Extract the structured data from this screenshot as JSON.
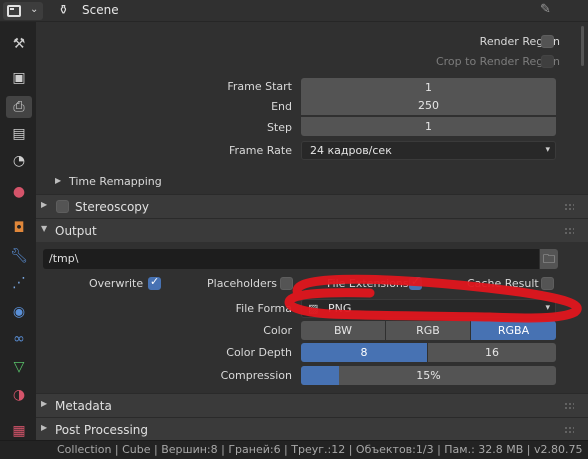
{
  "header": {
    "title": "Scene",
    "editor_icon": "properties-editor-icon",
    "pin_icon": "pin-icon"
  },
  "tabs": [
    {
      "name": "tool",
      "icon": "tool-icon"
    },
    {
      "name": "render",
      "icon": "render-camera-icon"
    },
    {
      "name": "output",
      "icon": "printer-icon",
      "active": true
    },
    {
      "name": "view-layer",
      "icon": "image-icon"
    },
    {
      "name": "scene",
      "icon": "scene-icon"
    },
    {
      "name": "world",
      "icon": "world-icon"
    },
    {
      "name": "object",
      "icon": "object-icon"
    },
    {
      "name": "modifiers",
      "icon": "wrench-icon"
    },
    {
      "name": "particles",
      "icon": "particles-icon"
    },
    {
      "name": "physics",
      "icon": "physics-icon"
    },
    {
      "name": "constraints",
      "icon": "constraint-icon"
    },
    {
      "name": "data",
      "icon": "mesh-data-icon"
    },
    {
      "name": "material",
      "icon": "material-icon"
    },
    {
      "name": "texture",
      "icon": "texture-icon"
    }
  ],
  "dimensions": {
    "render_region": {
      "label": "Render Region",
      "checked": false
    },
    "crop_region": {
      "label": "Crop to Render Region",
      "checked": false,
      "disabled": true
    },
    "frame_start": {
      "label": "Frame Start",
      "value": "1"
    },
    "frame_end": {
      "label": "End",
      "value": "250"
    },
    "frame_step": {
      "label": "Step",
      "value": "1"
    },
    "frame_rate": {
      "label": "Frame Rate",
      "value": "24 кадров/сек"
    },
    "time_remapping": {
      "label": "Time Remapping",
      "expanded": false
    }
  },
  "stereoscopy": {
    "label": "Stereoscopy",
    "checked": false,
    "expanded": false
  },
  "output": {
    "label": "Output",
    "expanded": true,
    "path": "/tmp\\",
    "overwrite": {
      "label": "Overwrite",
      "checked": true
    },
    "placeholders": {
      "label": "Placeholders",
      "checked": false
    },
    "file_extensions": {
      "label": "File Extensions",
      "checked": true
    },
    "cache_result": {
      "label": "Cache Result",
      "checked": false
    },
    "file_format": {
      "label": "File Forma",
      "value": "PNG"
    },
    "color": {
      "label": "Color",
      "options": [
        "BW",
        "RGB",
        "RGBA"
      ],
      "selected": "RGBA"
    },
    "color_depth": {
      "label": "Color Depth",
      "options": [
        "8",
        "16"
      ],
      "selected": "8"
    },
    "compression": {
      "label": "Compression",
      "value": "15%",
      "fraction": 0.15
    }
  },
  "metadata": {
    "label": "Metadata",
    "expanded": false
  },
  "post_processing": {
    "label": "Post Processing",
    "expanded": false
  },
  "status_bar": {
    "text": "Collection | Cube | Вершин:8 | Граней:6 | Треуг.:12 | Объектов:1/3 | Пам.: 32.8 MB | v2.80.75"
  },
  "colors": {
    "accent": "#4772b3",
    "annotation": "#e0161e",
    "panel": "#303030",
    "header": "#3a3a3a"
  }
}
